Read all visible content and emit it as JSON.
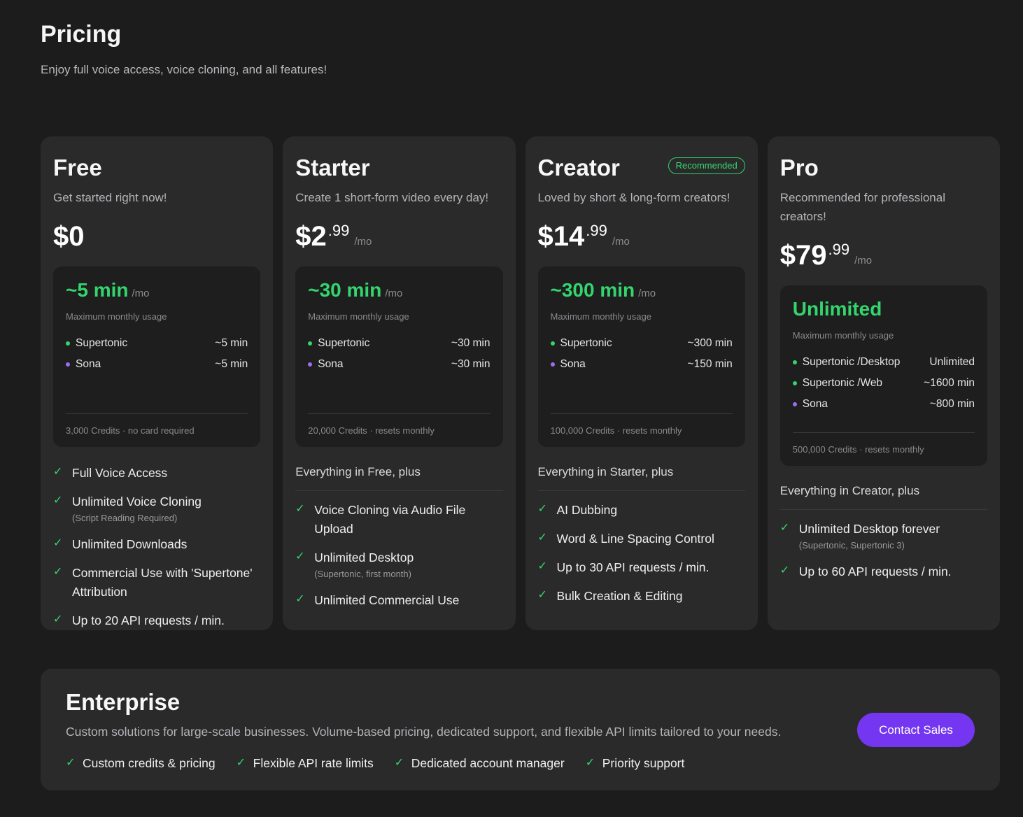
{
  "header": {
    "title": "Pricing",
    "subtitle": "Enjoy full voice access, voice cloning, and all features!"
  },
  "colors": {
    "accent_green": "#33d56c",
    "accent_purple": "#7436f0",
    "sona_dot": "#a06cf0"
  },
  "plans": [
    {
      "name": "Free",
      "description": "Get started right now!",
      "price_main": "$0",
      "price_cents": "",
      "price_unit": "",
      "usage_amount": "~5 min",
      "usage_unit": "/mo",
      "usage_label": "Maximum monthly usage",
      "usage_rows": [
        {
          "label": "Supertonic",
          "value": "~5 min",
          "dot": "green"
        },
        {
          "label": "Sona",
          "value": "~5 min",
          "dot": "purple"
        }
      ],
      "credits": "3,000 Credits · no card required",
      "inherit": "",
      "features": [
        {
          "text": "Full Voice Access",
          "note": ""
        },
        {
          "text": "Unlimited Voice Cloning",
          "note": "(Script Reading Required)"
        },
        {
          "text": "Unlimited Downloads",
          "note": ""
        },
        {
          "text": "Commercial Use with 'Supertone' Attribution",
          "note": ""
        },
        {
          "text": "Up to 20 API requests / min.",
          "note": ""
        }
      ]
    },
    {
      "name": "Starter",
      "description": "Create 1 short-form video every day!",
      "price_main": "$2",
      "price_cents": ".99",
      "price_unit": "/mo",
      "usage_amount": "~30 min",
      "usage_unit": "/mo",
      "usage_label": "Maximum monthly usage",
      "usage_rows": [
        {
          "label": "Supertonic",
          "value": "~30 min",
          "dot": "green"
        },
        {
          "label": "Sona",
          "value": "~30 min",
          "dot": "purple"
        }
      ],
      "credits": "20,000 Credits · resets monthly",
      "inherit": "Everything in Free, plus",
      "features": [
        {
          "text": "Voice Cloning via Audio File Upload",
          "note": ""
        },
        {
          "text": "Unlimited Desktop",
          "note": "(Supertonic, first month)"
        },
        {
          "text": "Unlimited Commercial Use",
          "note": ""
        }
      ]
    },
    {
      "name": "Creator",
      "badge": "Recommended",
      "description": "Loved by short & long-form creators!",
      "price_main": "$14",
      "price_cents": ".99",
      "price_unit": "/mo",
      "usage_amount": "~300 min",
      "usage_unit": "/mo",
      "usage_label": "Maximum monthly usage",
      "usage_rows": [
        {
          "label": "Supertonic",
          "value": "~300 min",
          "dot": "green"
        },
        {
          "label": "Sona",
          "value": "~150 min",
          "dot": "purple"
        }
      ],
      "credits": "100,000 Credits · resets monthly",
      "inherit": "Everything in Starter, plus",
      "features": [
        {
          "text": "AI Dubbing",
          "note": ""
        },
        {
          "text": "Word & Line Spacing Control",
          "note": ""
        },
        {
          "text": "Up to 30 API requests / min.",
          "note": ""
        },
        {
          "text": "Bulk Creation & Editing",
          "note": ""
        }
      ]
    },
    {
      "name": "Pro",
      "description": "Recommended for professional creators!",
      "price_main": "$79",
      "price_cents": ".99",
      "price_unit": "/mo",
      "usage_amount": "Unlimited",
      "usage_unit": "",
      "usage_label": "Maximum monthly usage",
      "usage_rows": [
        {
          "label": "Supertonic /Desktop",
          "value": "Unlimited",
          "dot": "green"
        },
        {
          "label": "Supertonic /Web",
          "value": "~1600 min",
          "dot": "green"
        },
        {
          "label": "Sona",
          "value": "~800 min",
          "dot": "purple"
        }
      ],
      "credits": "500,000 Credits · resets monthly",
      "inherit": "Everything in Creator, plus",
      "features": [
        {
          "text": "Unlimited Desktop forever",
          "note": "(Supertonic, Supertonic 3)"
        },
        {
          "text": "Up to 60 API requests / min.",
          "note": ""
        }
      ]
    }
  ],
  "enterprise": {
    "title": "Enterprise",
    "description": "Custom solutions for large-scale businesses. Volume-based pricing, dedicated support, and flexible API limits tailored to your needs.",
    "button": "Contact Sales",
    "features": [
      "Custom credits & pricing",
      "Flexible API rate limits",
      "Dedicated account manager",
      "Priority support"
    ]
  }
}
